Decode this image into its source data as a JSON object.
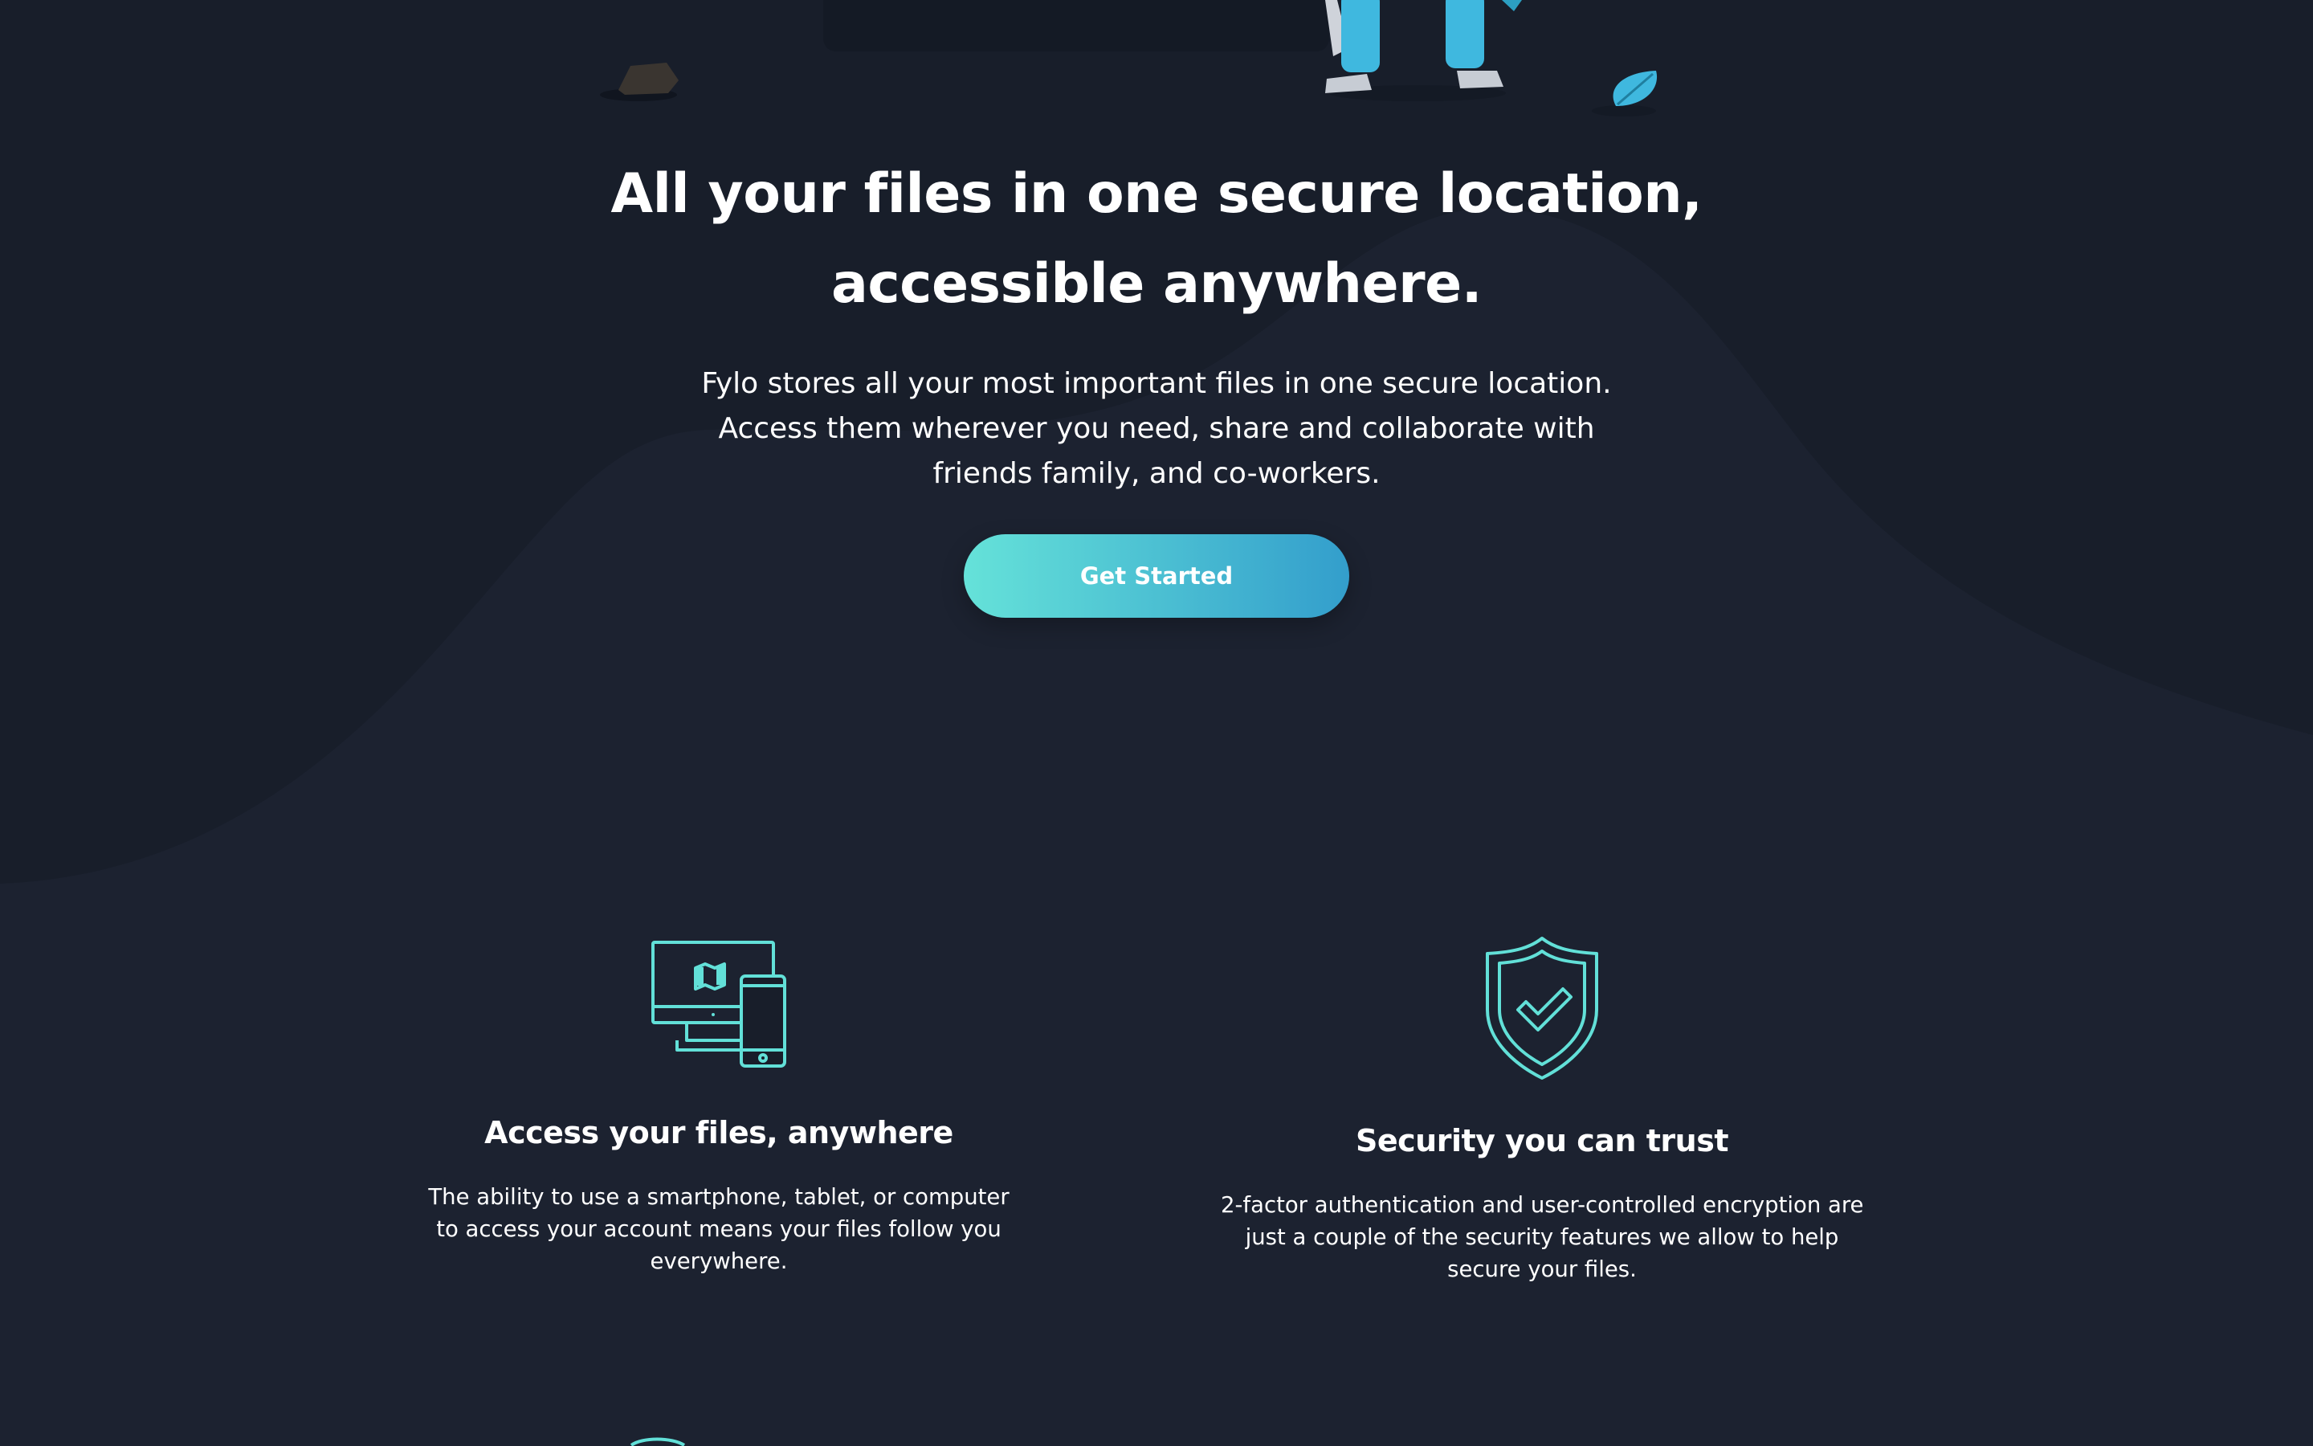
{
  "hero": {
    "title_lines": [
      "All your files in one secure location,",
      "accessible anywhere."
    ],
    "text_lines": [
      "Fylo stores all your most important files in one secure location.",
      "Access them wherever you need, share and collaborate with",
      "friends family, and co-workers."
    ],
    "cta_label": "Get Started"
  },
  "features": [
    {
      "icon": "devices-icon",
      "title": "Access your files, anywhere",
      "text_lines": [
        "The ability to use a smartphone, tablet, or computer",
        "to access your account means your files follow you",
        "everywhere."
      ]
    },
    {
      "icon": "shield-check-icon",
      "title": "Security you can trust",
      "text_lines": [
        "2-factor authentication and user-controlled encryption are",
        "just a couple of the security features we allow to help",
        "secure your files."
      ]
    }
  ],
  "colors": {
    "background": "#181e2a",
    "curve": "#1c2230",
    "accent_start": "#65e2d9",
    "accent_end": "#339ecc",
    "icon_stroke": "#62e0d8",
    "text": "#ffffff"
  }
}
